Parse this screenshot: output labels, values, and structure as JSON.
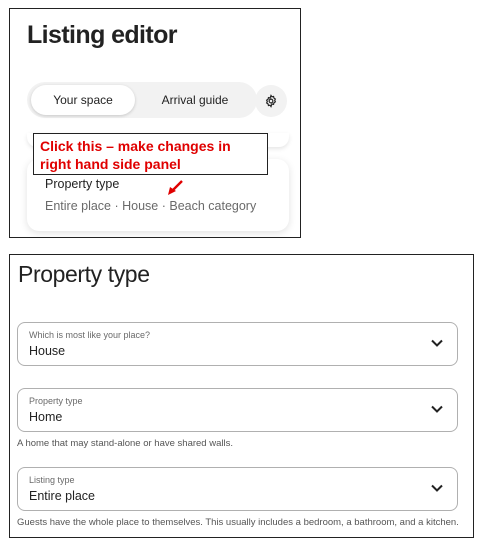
{
  "editor": {
    "title": "Listing editor",
    "tabs": [
      {
        "label": "Your space",
        "active": true
      },
      {
        "label": "Arrival guide",
        "active": false
      }
    ],
    "settings_icon": "gear-icon",
    "card": {
      "title": "Property type",
      "subtitle": "Entire place · House · Beach category"
    },
    "callout": {
      "text": "Click this – make changes in right hand side panel",
      "color": "#e00000"
    }
  },
  "property_panel": {
    "title": "Property type",
    "fields": [
      {
        "label": "Which is most like your place?",
        "value": "House",
        "help": ""
      },
      {
        "label": "Property type",
        "value": "Home",
        "help": "A home that may stand-alone or have shared walls."
      },
      {
        "label": "Listing type",
        "value": "Entire place",
        "help": "Guests have the whole place to themselves. This usually includes a bedroom, a bathroom, and a kitchen."
      }
    ],
    "dropdown_icon": "chevron-down-icon"
  }
}
